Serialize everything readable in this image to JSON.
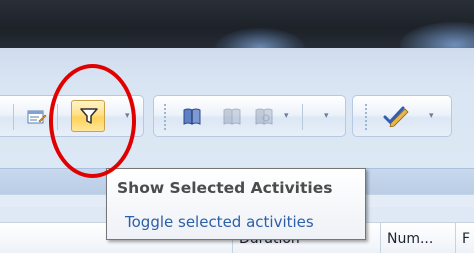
{
  "tooltip": {
    "title": "Show Selected Activities",
    "description": "Toggle selected activities"
  },
  "columns": [
    "",
    "Duration",
    "Num...",
    "F"
  ],
  "icons": {
    "view": "view-properties-icon",
    "filter": "filter-funnel-icon",
    "book1": "book-icon",
    "book2": "book-icon",
    "book3": "book-search-icon",
    "pen": "pencil-check-icon"
  },
  "colors": {
    "highlight": "#e00000",
    "active_button": "#ffd25a",
    "tooltip_desc": "#2d5ea8"
  }
}
